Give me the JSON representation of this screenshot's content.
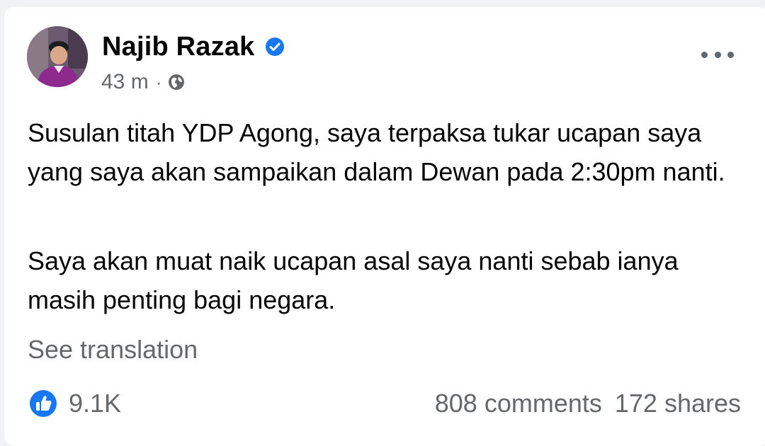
{
  "post": {
    "author": {
      "name": "Najib Razak",
      "verified": true,
      "avatar_icon": "profile-photo",
      "verified_icon": "verified-badge-icon",
      "verified_color": "#1877f2"
    },
    "meta": {
      "time": "43 m",
      "separator": "·",
      "audience_icon": "globe-icon"
    },
    "more_icon": "more-options-icon",
    "body": {
      "paragraph_1": "Susulan titah YDP Agong, saya terpaksa tukar ucapan saya yang saya akan sampaikan dalam Dewan pada 2:30pm nanti.",
      "paragraph_2": "Saya akan muat naik ucapan asal saya nanti sebab ianya masih penting bagi negara."
    },
    "see_translation": "See translation",
    "stats": {
      "reaction_icon": "like-icon",
      "reaction_count": "9.1K",
      "comments": "808 comments",
      "shares": "172 shares"
    }
  },
  "colors": {
    "page_background": "#f0f2f5",
    "card_background": "#ffffff",
    "primary_text": "#050505",
    "secondary_text": "#65676b",
    "brand_blue": "#1877f2"
  }
}
